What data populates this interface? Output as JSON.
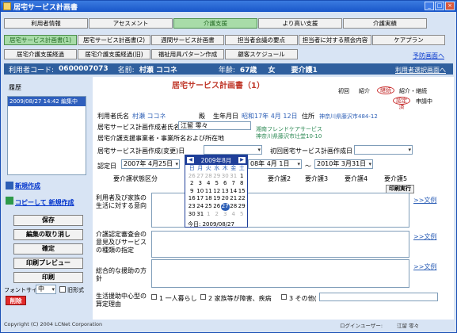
{
  "window": {
    "title": "居宅サービス計画書",
    "minimize": "_",
    "maximize": "□",
    "close": "×"
  },
  "nav_row1": [
    "利用者情報",
    "アセスメント",
    "介護支援",
    "より高い支援",
    "介護実績"
  ],
  "nav_row2": [
    "居宅サービス計画書(1)",
    "居宅サービス計画書(2)",
    "週間サービス計画書",
    "担当者会議の要点",
    "担当者に対する照会内容",
    "ケアプラン"
  ],
  "nav_row3": [
    "居宅介護支援経過",
    "居宅介護支援経過(旧)",
    "福祉用具パターン作成",
    "顧客スケジュール"
  ],
  "forecast_link": "予防画面へ",
  "info": {
    "user_code_label": "利用者コード:",
    "user_code": "0600007073",
    "name_label": "名前:",
    "name": "村瀬 ココネ",
    "age_label": "年齢:",
    "age": "67歳",
    "gender": "女",
    "care_level": "要介護1"
  },
  "prev_screen_link": "利用者選択画面へ",
  "history": {
    "label": "履歴",
    "items": [
      "2009/08/27 14:42 編集中"
    ]
  },
  "sidebar": {
    "new_create": "新規作成",
    "copy_create": "コピーして 新規作成",
    "save": "保存",
    "cancel_edit": "編集の取り消し",
    "confirm": "確定",
    "print_preview": "印刷プレビュー",
    "print": "印刷",
    "font_size_label": "フォントサイズ",
    "font_size": "中",
    "old_format": "旧形式",
    "delete": "削除"
  },
  "plan": {
    "title": "居宅サービス計画書（1）",
    "status_labels": [
      "初回",
      "紹介",
      "継続",
      "紹介・継続"
    ],
    "status_selected": "紹介",
    "cert_status": [
      "認定済",
      "申請中"
    ],
    "user_name_label": "利用者氏名",
    "user_name": "村瀬 ココネ",
    "honorific": "殿",
    "birth_label": "生年月日",
    "birth": "昭和17年 4月 12日",
    "address_label": "住所",
    "address": "神奈川県藤沢市484-12",
    "creator_label": "居宅サービス計画作成者氏名",
    "creator": "江留 零々",
    "office_label": "居宅介護支援事業者・事業所名および所在地",
    "office_name": "湘南フレンドケアサービス",
    "office_address": "神奈川県藤沢市辻堂10-10",
    "created_date_label": "居宅サービス計画作成(変更)日",
    "first_created_label": "初回居宅サービス計画作成日",
    "cert_date_label": "認定日",
    "cert_date": "2007年 4月25日",
    "valid_label": "認定の有効期間",
    "valid_from": "08年 4月 1日",
    "tilde": "～",
    "valid_to": "2010年 3月31日",
    "care_level_label": "要介護状態区分",
    "care_levels": [
      "要介護1",
      "要介護2",
      "要介護3",
      "要介護4",
      "要介護5"
    ],
    "print_button": "印刷実行",
    "section1": "利用者及び家族の生活に対する意向",
    "section2": "介護認定審査会の意見及びサービスの種類の指定",
    "section3": "総合的な援助の方針",
    "section4": "生活援助中心型の算定理由",
    "example_link": ">>文例",
    "reasons": [
      "1 一人暮らし",
      "2 家族等が障害、疾病",
      "3 その他("
    ]
  },
  "calendar": {
    "month": "2009年8月",
    "weekdays": [
      "日",
      "月",
      "火",
      "水",
      "木",
      "金",
      "土"
    ],
    "days": [
      "26",
      "27",
      "28",
      "29",
      "30",
      "31",
      "1",
      "2",
      "3",
      "4",
      "5",
      "6",
      "7",
      "8",
      "9",
      "10",
      "11",
      "12",
      "13",
      "14",
      "15",
      "16",
      "17",
      "18",
      "19",
      "20",
      "21",
      "22",
      "23",
      "24",
      "25",
      "26",
      "27",
      "28",
      "29",
      "30",
      "31",
      "1",
      "2",
      "3",
      "4",
      "5"
    ],
    "selected": "27",
    "today_label": "今日: 2009/08/27"
  },
  "footer": {
    "copyright": "Copyright (C) 2004 LCNet Corporation",
    "login_label": "ログインユーザー:",
    "login_user": "江留 零々"
  }
}
